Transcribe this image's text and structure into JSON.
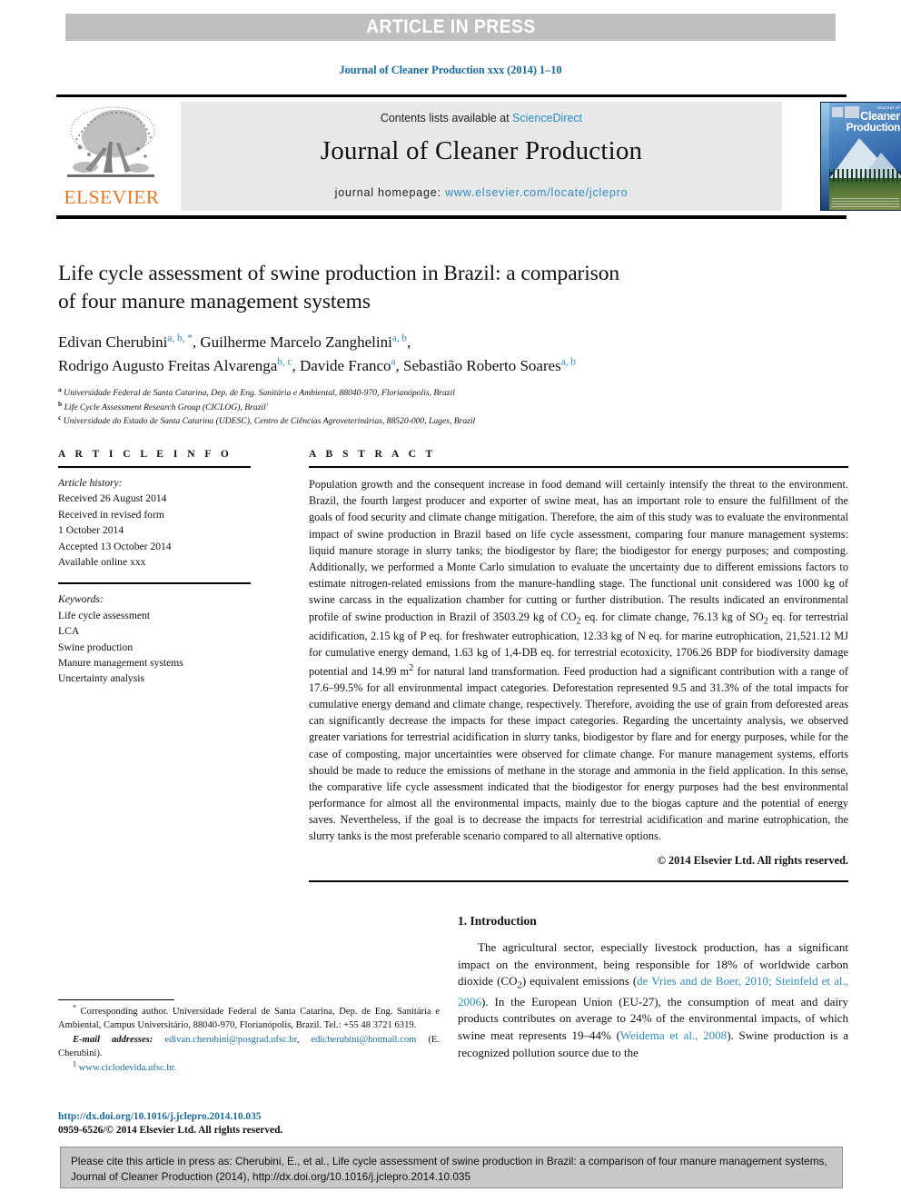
{
  "press_banner": "ARTICLE IN PRESS",
  "running_head": "Journal of Cleaner Production xxx (2014) 1–10",
  "masthead": {
    "contents_prefix": "Contents lists available at ",
    "sciencedirect": "ScienceDirect",
    "journal_title": "Journal of Cleaner Production",
    "homepage_prefix": "journal homepage: ",
    "homepage_url": "www.elsevier.com/locate/jclepro",
    "publisher": "ELSEVIER",
    "cover": {
      "kicker": "Journal of",
      "line1": "Cleaner",
      "line2": "Production"
    }
  },
  "article": {
    "title_line1": "Life cycle assessment of swine production in Brazil: a comparison",
    "title_line2": "of four manure management systems",
    "authors_line1_a": "Edivan Cherubini",
    "authors_line1_a_sup": "a, b, *",
    "authors_line1_b": ", Guilherme Marcelo Zanghelini",
    "authors_line1_b_sup": "a, b",
    "authors_line1_tail": ",",
    "authors_line2_a": "Rodrigo Augusto Freitas Alvarenga",
    "authors_line2_a_sup": "b, c",
    "authors_line2_b": ", Davide Franco",
    "authors_line2_b_sup": "a",
    "authors_line2_c": ", Sebastião Roberto Soares",
    "authors_line2_c_sup": "a, b",
    "affiliations": [
      {
        "label": "a",
        "text": "Universidade Federal de Santa Catarina, Dep. de Eng. Sanitária e Ambiental, 88040-970, Florianópolis, Brazil"
      },
      {
        "label": "b",
        "text": "Life Cycle Assessment Research Group (CICLOG), Brazil",
        "note": "1"
      },
      {
        "label": "c",
        "text": "Universidade do Estado de Santa Catarina (UDESC), Centro de Ciências Agroveterinárias, 88520-000, Lages, Brazil"
      }
    ]
  },
  "article_info": {
    "heading": "A R T I C L E   I N F O",
    "history_label": "Article history:",
    "history": [
      "Received 26 August 2014",
      "Received in revised form",
      "1 October 2014",
      "Accepted 13 October 2014",
      "Available online xxx"
    ],
    "keywords_label": "Keywords:",
    "keywords": [
      "Life cycle assessment",
      "LCA",
      "Swine production",
      "Manure management systems",
      "Uncertainty analysis"
    ]
  },
  "abstract": {
    "heading": "A B S T R A C T",
    "text": "Population growth and the consequent increase in food demand will certainly intensify the threat to the environment. Brazil, the fourth largest producer and exporter of swine meat, has an important role to ensure the fulfillment of the goals of food security and climate change mitigation. Therefore, the aim of this study was to evaluate the environmental impact of swine production in Brazil based on life cycle assessment, comparing four manure management systems: liquid manure storage in slurry tanks; the biodigestor by flare; the biodigestor for energy purposes; and composting. Additionally, we performed a Monte Carlo simulation to evaluate the uncertainty due to different emissions factors to estimate nitrogen-related emissions from the manure-handling stage. The functional unit considered was 1000 kg of swine carcass in the equalization chamber for cutting or further distribution. The results indicated an environmental profile of swine production in Brazil of 3503.29 kg of CO2 eq. for climate change, 76.13 kg of SO2 eq. for terrestrial acidification, 2.15 kg of P eq. for freshwater eutrophication, 12.33 kg of N eq. for marine eutrophication, 21,521.12 MJ for cumulative energy demand, 1.63 kg of 1,4-DB eq. for terrestrial ecotoxicity, 1706.26 BDP for biodiversity damage potential and 14.99 m2 for natural land transformation. Feed production had a significant contribution with a range of 17.6–99.5% for all environmental impact categories. Deforestation represented 9.5 and 31.3% of the total impacts for cumulative energy demand and climate change, respectively. Therefore, avoiding the use of grain from deforested areas can significantly decrease the impacts for these impact categories. Regarding the uncertainty analysis, we observed greater variations for terrestrial acidification in slurry tanks, biodigestor by flare and for energy purposes, while for the case of composting, major uncertainties were observed for climate change. For manure management systems, efforts should be made to reduce the emissions of methane in the storage and ammonia in the field application. In this sense, the comparative life cycle assessment indicated that the biodigestor for energy purposes had the best environmental performance for almost all the environmental impacts, mainly due to the biogas capture and the potential of energy saves. Nevertheless, if the goal is to decrease the impacts for terrestrial acidification and marine eutrophication, the slurry tanks is the most preferable scenario compared to all alternative options.",
    "copyright": "© 2014 Elsevier Ltd. All rights reserved."
  },
  "introduction": {
    "heading": "1. Introduction",
    "paragraph_part1": "The agricultural sector, especially livestock production, has a significant impact on the environment, being responsible for 18% of worldwide carbon dioxide (CO2) equivalent emissions (",
    "citation1": "de Vries and de Boer, 2010; Steinfeld et al., 2006",
    "paragraph_part2": "). In the European Union (EU-27), the consumption of meat and dairy products contributes on average to 24% of the environmental impacts, of which swine meat represents 19–44% (",
    "citation2": "Weidema et al., 2008",
    "paragraph_part3": "). Swine production is a recognized pollution source due to the"
  },
  "footnotes": {
    "corresponding_mark": "*",
    "corresponding": "Corresponding author. Universidade Federal de Santa Catarina, Dep. de Eng. Sanitária e Ambiental, Campus Universitário, 88040-970, Florianópolis, Brazil. Tel.: +55 48 3721 6319.",
    "email_label": "E-mail addresses:",
    "email1": "edivan.cherubini@posgrad.ufsc.br",
    "email2": "edicherubini@hotmail.com",
    "email_attrib": "(E. Cherubini).",
    "note_mark": "1",
    "note_url": "www.ciclodevida.ufsc.br.",
    "doi": "http://dx.doi.org/10.1016/j.jclepro.2014.10.035",
    "issn": "0959-6526/© 2014 Elsevier Ltd. All rights reserved."
  },
  "cite_box": {
    "text": "Please cite this article in press as: Cherubini, E., et al., Life cycle assessment of swine production in Brazil: a comparison of four manure management systems, Journal of Cleaner Production (2014), http://dx.doi.org/10.1016/j.jclepro.2014.10.035"
  },
  "colors": {
    "link_blue": "#2b8cc4",
    "header_blue": "#1a6ba0",
    "elsevier_orange": "#E87722",
    "banner_grey": "#bfbfbf",
    "panel_grey": "#e8e8e8",
    "cite_box_grey": "#c8c8c8"
  }
}
